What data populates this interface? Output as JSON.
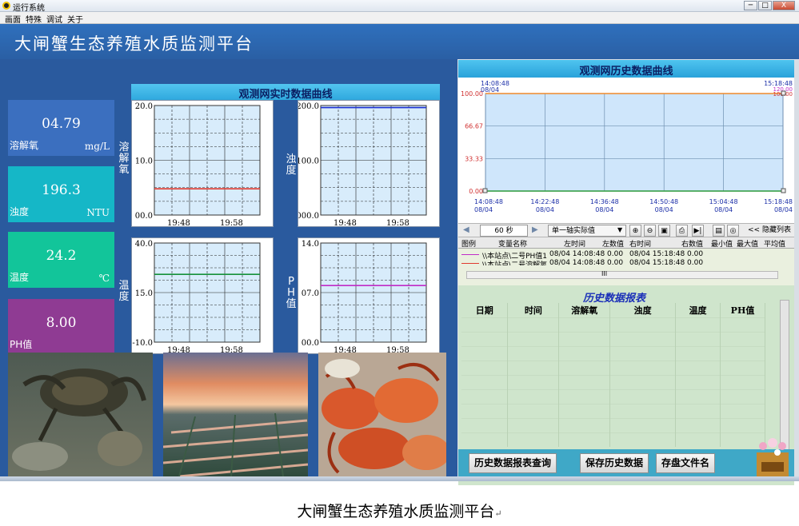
{
  "window": {
    "title": "运行系统",
    "minimize": "─",
    "maximize": "□",
    "close": "X"
  },
  "menu": [
    "画面",
    "特殊",
    "调试",
    "关于"
  ],
  "header": {
    "title": "大闸蟹生态养殖水质监测平台"
  },
  "tiles": [
    {
      "value": "04.79",
      "name": "溶解氧",
      "unit": "mg/L",
      "color": "#3b6fbf"
    },
    {
      "value": "196.3",
      "name": "浊度",
      "unit": "NTU",
      "color": "#15b7c7"
    },
    {
      "value": "24.2",
      "name": "温度",
      "unit": "℃",
      "color": "#12c59a"
    },
    {
      "value": "8.00",
      "name": "PH值",
      "unit": "",
      "color": "#8f3b93"
    }
  ],
  "realtime": {
    "title": "观测网实时数据曲线",
    "charts": [
      {
        "label": "溶解氧",
        "y_ticks": [
          "20.0",
          "10.0",
          "00.0"
        ],
        "x_ticks": [
          "19:48",
          "19:58"
        ],
        "line_color": "#e03a2f"
      },
      {
        "label": "浊度",
        "y_ticks": [
          "200.0",
          "100.0",
          "000.0"
        ],
        "x_ticks": [
          "19:48",
          "19:58"
        ],
        "line_color": "#1c2fd1"
      },
      {
        "label": "温度",
        "y_ticks": [
          "40.0",
          "15.0",
          "-10.0"
        ],
        "x_ticks": [
          "19:48",
          "19:58"
        ],
        "line_color": "#15913a"
      },
      {
        "label": "PH值",
        "y_ticks": [
          "14.0",
          "07.0",
          "00.0"
        ],
        "x_ticks": [
          "19:48",
          "19:58"
        ],
        "line_color": "#c02bc7"
      }
    ]
  },
  "chart_data": [
    {
      "type": "line",
      "title": "观测网实时数据曲线",
      "ylabel": "溶解氧",
      "ylim": [
        0,
        20
      ],
      "x": [
        "19:48",
        "19:58"
      ],
      "series": [
        {
          "values": [
            4.79,
            4.79
          ]
        }
      ]
    },
    {
      "type": "line",
      "ylabel": "浊度",
      "ylim": [
        0,
        200
      ],
      "x": [
        "19:48",
        "19:58"
      ],
      "series": [
        {
          "values": [
            196.3,
            196.3
          ]
        }
      ]
    },
    {
      "type": "line",
      "ylabel": "温度",
      "ylim": [
        -10,
        40
      ],
      "x": [
        "19:48",
        "19:58"
      ],
      "series": [
        {
          "values": [
            24.2,
            24.2
          ]
        }
      ]
    },
    {
      "type": "line",
      "ylabel": "PH值",
      "ylim": [
        0,
        14
      ],
      "x": [
        "19:48",
        "19:58"
      ],
      "series": [
        {
          "values": [
            8.0,
            8.0
          ]
        }
      ]
    },
    {
      "type": "line",
      "title": "观测网历史数据曲线",
      "ylim": [
        0,
        100
      ],
      "y_ticks": [
        "100.00",
        "66.67",
        "33.33",
        "0.00"
      ],
      "x_ticks": [
        [
          "14:08:48",
          "08/04"
        ],
        [
          "14:22:48",
          "08/04"
        ],
        [
          "14:36:48",
          "08/04"
        ],
        [
          "14:50:48",
          "08/04"
        ],
        [
          "15:04:48",
          "08/04"
        ],
        [
          "15:18:48",
          "08/04"
        ]
      ],
      "series": [
        {
          "values": [
            100,
            100
          ]
        },
        {
          "values": [
            0,
            0
          ]
        }
      ]
    }
  ],
  "history": {
    "title": "观测网历史数据曲线",
    "y_ticks": [
      "100.00",
      "66.67",
      "33.33",
      "0.00"
    ],
    "x_ticks": [
      {
        "time": "14:08:48",
        "date": "08/04"
      },
      {
        "time": "14:22:48",
        "date": "08/04"
      },
      {
        "time": "14:36:48",
        "date": "08/04"
      },
      {
        "time": "14:50:48",
        "date": "08/04"
      },
      {
        "time": "15:04:48",
        "date": "08/04"
      },
      {
        "time": "15:18:48",
        "date": "08/04"
      }
    ],
    "top_left": {
      "time": "14:08:48",
      "date": "08/04"
    },
    "top_right": {
      "time": "15:18:48",
      "date": "08/04",
      "val1": "100.00",
      "val2": "120.00"
    },
    "line_top_color": "#f08a2a",
    "line_bottom_color": "#2c9a3a"
  },
  "toolbar": {
    "interval": "60 秒",
    "axis_mode": "单一轴实际值",
    "hide_list": "<< 隐藏列表"
  },
  "legend": {
    "headers": [
      "图例",
      "变量名称",
      "左时间",
      "左数值",
      "右时间",
      "右数值",
      "最小值",
      "最大值",
      "平均值"
    ],
    "rows": [
      {
        "color": "#c02bc7",
        "name": "\\\\本站点\\二号PH值1",
        "left_time": "08/04 14:08:48",
        "left_val": "0.00",
        "right_time": "08/04 15:18:48",
        "right_val": "0.00"
      },
      {
        "color": "#e03a2f",
        "name": "\\\\本站点\\二号溶解氧",
        "left_time": "08/04 14:08:48",
        "left_val": "0.00",
        "right_time": "08/04 15:18:48",
        "right_val": "0.00"
      }
    ],
    "scroll_mark": "III"
  },
  "report": {
    "title": "历史数据报表",
    "columns": [
      "日期",
      "时间",
      "溶解氧",
      "浊度",
      "温度",
      "PH值"
    ]
  },
  "buttons": {
    "query": "历史数据报表查询",
    "save": "保存历史数据",
    "filename": "存盘文件名"
  },
  "caption": {
    "text": "大闸蟹生态养殖水质监测平台",
    "return_mark": "↵"
  }
}
